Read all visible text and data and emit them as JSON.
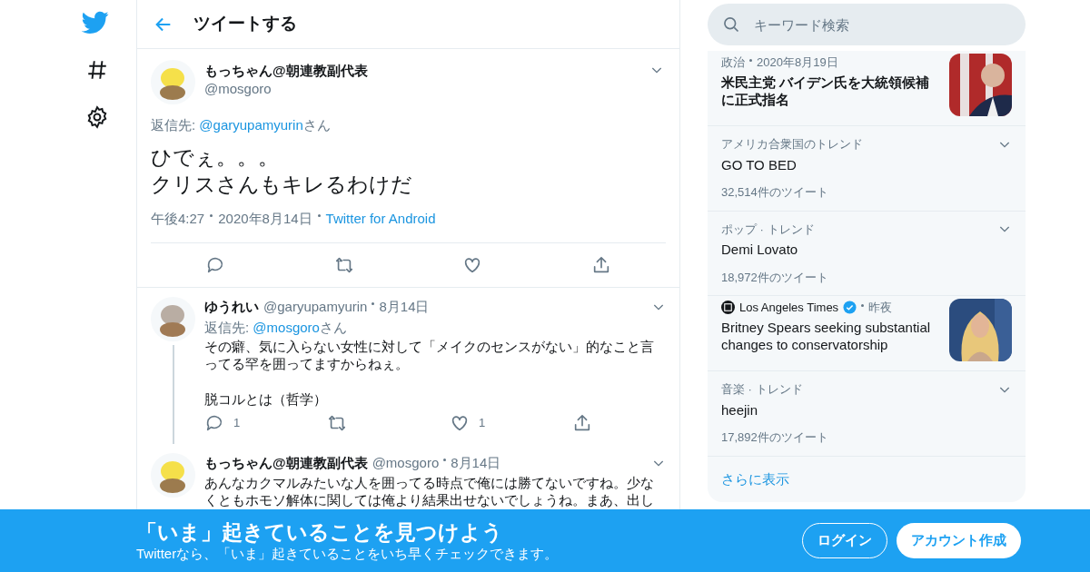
{
  "header": {
    "title": "ツイートする"
  },
  "nav": [
    {
      "kind": "hash"
    },
    {
      "kind": "gear"
    }
  ],
  "main_tweet": {
    "name": "もっちゃん@朝連教副代表",
    "handle": "@mosgoro",
    "reply_label": "返信先: ",
    "reply_to": "@garyupamyurin",
    "reply_suffix": "さん",
    "lines": [
      "ひでぇ。。。",
      "クリスさんもキレるわけだ"
    ],
    "time": "午後4:27",
    "date": "2020年8月14日",
    "source": "Twitter for Android"
  },
  "replies": [
    {
      "name": "ゆうれい",
      "handle": "@garyupamyurin",
      "date": "8月14日",
      "kind": "ghost",
      "reply_label": "返信先: ",
      "reply_to": "@mosgoro",
      "reply_suffix": "さん",
      "paragraphs": [
        "その癖、気に入らない女性に対して「メイクのセンスがない」的なこと言ってる罕を囲ってますからねぇ。",
        "脱コルとは（哲学）"
      ],
      "reply_count": "1",
      "like_count": "1"
    },
    {
      "name": "もっちゃん@朝連教副代表",
      "handle": "@mosgoro",
      "date": "8月14日",
      "kind": "yellow",
      "paragraphs": [
        "あんなカクマルみたいな人を囲ってる時点で俺には勝てないですね。少なくともホモソ解体に関しては俺より結果出せないでしょうね。まあ、出し"
      ]
    }
  ],
  "search": {
    "placeholder": "キーワード検索"
  },
  "trends": [
    {
      "kind": "news",
      "meta": "政治",
      "date": "2020年8月19日",
      "title": "米民主党 バイデン氏を大統領候補に正式指名"
    },
    {
      "kind": "trend",
      "meta": "アメリカ合衆国のトレンド",
      "title": "GO TO BED",
      "count": "32,514件のツイート"
    },
    {
      "kind": "trend",
      "meta": "ポップ · トレンド",
      "title": "Demi Lovato",
      "count": "18,972件のツイート"
    },
    {
      "kind": "publisher",
      "meta": "Los Angeles Times",
      "date": "昨夜",
      "title": "Britney Spears seeking substantial changes to conservatorship"
    },
    {
      "kind": "trend",
      "meta": "音楽 · トレンド",
      "title": "heejin",
      "count": "17,892件のツイート"
    }
  ],
  "show_more": "さらに表示",
  "banner": {
    "title": "「いま」起きていることを見つけよう",
    "subtitle": "Twitterなら、「いま」起きていることをいち早くチェックできます。",
    "login": "ログイン",
    "signup": "アカウント作成"
  }
}
